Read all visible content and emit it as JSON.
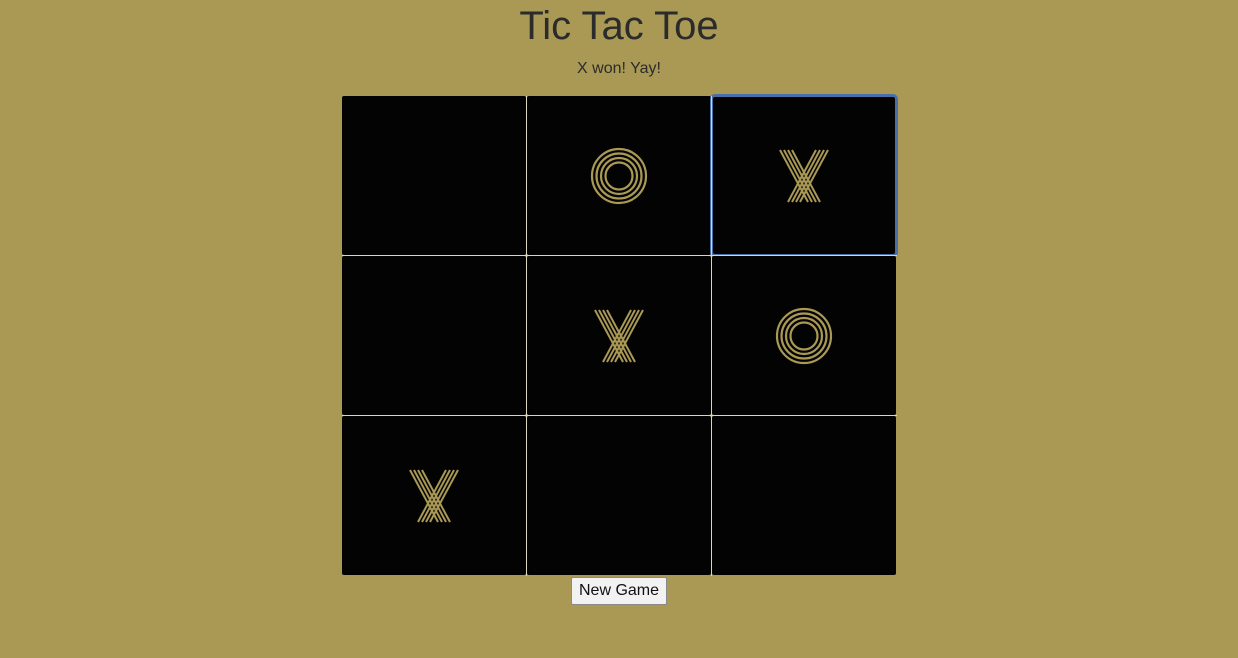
{
  "title": "Tic Tac Toe",
  "status": "X won! Yay!",
  "board": {
    "cells": [
      "",
      "O",
      "X",
      "",
      "X",
      "O",
      "X",
      "",
      ""
    ],
    "focused_cell": 2
  },
  "new_game_label": "New Game",
  "colors": {
    "background": "#aa9955",
    "cell": "#030303",
    "mark": "#aa9955",
    "grid_line": "#d9d6c6",
    "focus_ring": "#4a6fa8"
  },
  "icons": {
    "x_mark": "x-mark-icon",
    "o_mark": "o-mark-icon"
  }
}
